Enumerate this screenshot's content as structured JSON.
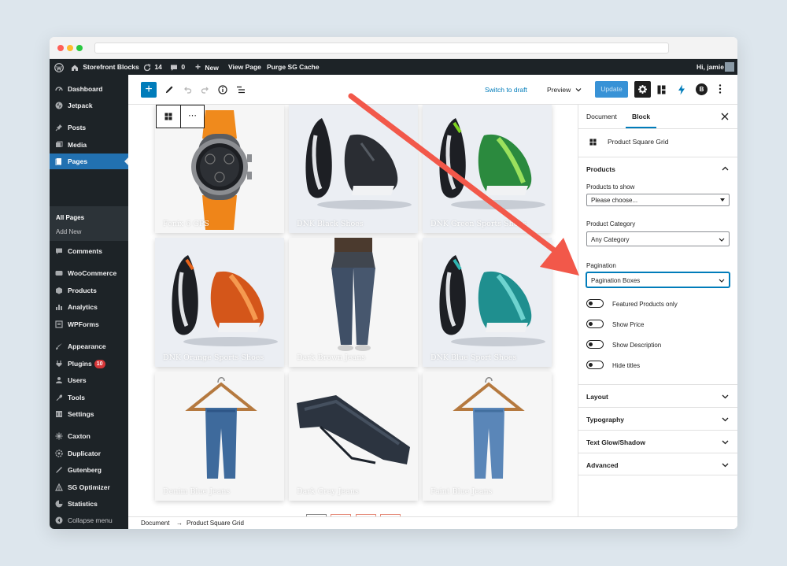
{
  "admin_bar": {
    "site_name": "Storefront Blocks",
    "updates_count": "14",
    "comments_count": "0",
    "new_label": "New",
    "view_page_label": "View Page",
    "purge_cache_label": "Purge SG Cache",
    "greeting": "Hi, jamie"
  },
  "sidebar": {
    "items": [
      {
        "label": "Dashboard",
        "icon": "dashboard-icon"
      },
      {
        "label": "Jetpack",
        "icon": "jetpack-icon"
      },
      {
        "label": "Posts",
        "icon": "pin-icon"
      },
      {
        "label": "Media",
        "icon": "media-icon"
      },
      {
        "label": "Pages",
        "icon": "pages-icon",
        "active": true
      },
      {
        "label": "Comments",
        "icon": "comment-icon"
      },
      {
        "label": "WooCommerce",
        "icon": "woocommerce-icon"
      },
      {
        "label": "Products",
        "icon": "products-icon"
      },
      {
        "label": "Analytics",
        "icon": "analytics-icon"
      },
      {
        "label": "WPForms",
        "icon": "wpforms-icon"
      },
      {
        "label": "Appearance",
        "icon": "brush-icon"
      },
      {
        "label": "Plugins",
        "icon": "plugin-icon",
        "badge": "10"
      },
      {
        "label": "Users",
        "icon": "users-icon"
      },
      {
        "label": "Tools",
        "icon": "tools-icon"
      },
      {
        "label": "Settings",
        "icon": "settings-icon"
      },
      {
        "label": "Caxton",
        "icon": "caxton-icon"
      },
      {
        "label": "Duplicator",
        "icon": "duplicator-icon"
      },
      {
        "label": "Gutenberg",
        "icon": "gutenberg-icon"
      },
      {
        "label": "SG Optimizer",
        "icon": "sg-optimizer-icon"
      },
      {
        "label": "Statistics",
        "icon": "statistics-icon"
      },
      {
        "label": "Collapse menu",
        "icon": "collapse-icon"
      }
    ],
    "submenu": [
      "All Pages",
      "Add New"
    ]
  },
  "toolbar": {
    "switch_to_draft": "Switch to draft",
    "preview": "Preview",
    "update": "Update",
    "plugin_badge": "B"
  },
  "products": [
    {
      "title": "Fenix 6 GPS"
    },
    {
      "title": "DNK Black Shoes"
    },
    {
      "title": "DNK Green Sports Shoes"
    },
    {
      "title": "DNK Orange Sports Shoes"
    },
    {
      "title": "Dark Brown Jeans"
    },
    {
      "title": "DNK Blue Sport Shoes"
    },
    {
      "title": "Denim Blue Jeans"
    },
    {
      "title": "Dark Grey Jeans"
    },
    {
      "title": "Faint Blue Jeans"
    }
  ],
  "breadcrumb": {
    "root": "Document",
    "separator": "→",
    "current": "Product Square Grid"
  },
  "panel": {
    "tabs": [
      "Document",
      "Block"
    ],
    "block_name": "Product Square Grid",
    "products_section": "Products",
    "products_to_show_label": "Products to show",
    "products_to_show_value": "Please choose...",
    "category_label": "Product Category",
    "category_value": "Any Category",
    "pagination_label": "Pagination",
    "pagination_value": "Pagination Boxes",
    "toggles": [
      "Featured Products only",
      "Show Price",
      "Show Description",
      "Hide titles"
    ],
    "sections": [
      "Layout",
      "Typography",
      "Text Glow/Shadow",
      "Advanced"
    ]
  },
  "colors": {
    "admin_dark": "#1d2327",
    "wp_blue": "#2271b1",
    "editor_blue": "#007cba",
    "annotation_arrow": "#f2584a"
  }
}
